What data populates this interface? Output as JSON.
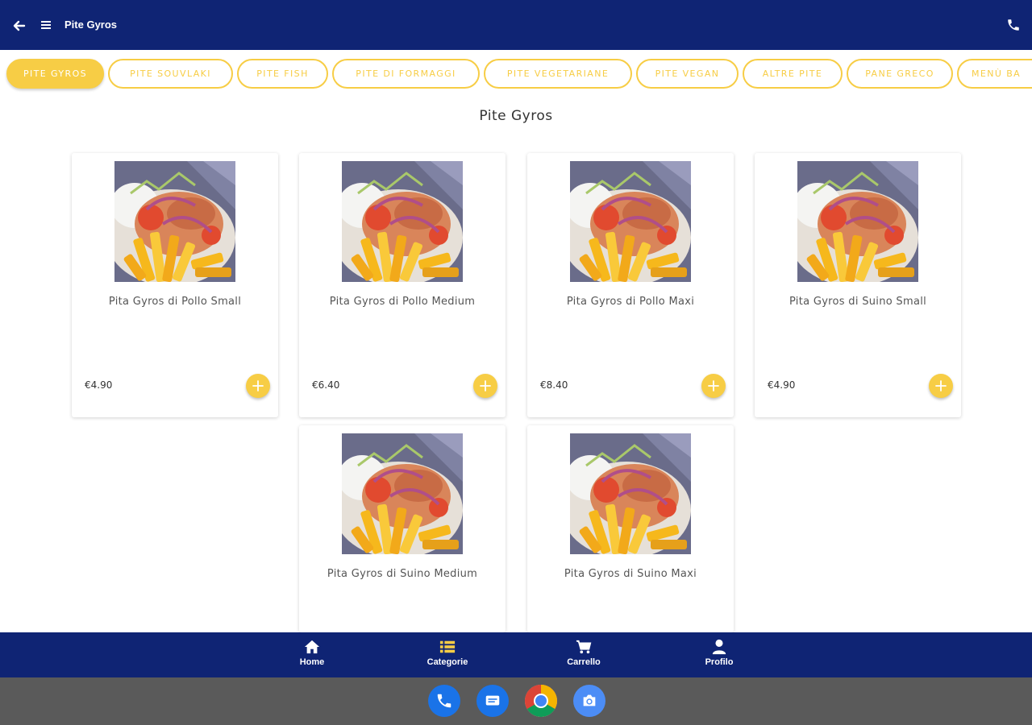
{
  "topbar": {
    "title": "Pite Gyros",
    "back_icon": "arrow-back-icon",
    "menu_icon": "hamburger-menu-icon",
    "phone_icon": "phone-icon"
  },
  "categories": [
    {
      "label": "PITE GYROS",
      "active": true
    },
    {
      "label": "PITE SOUVLAKI",
      "active": false
    },
    {
      "label": "PITE FISH",
      "active": false
    },
    {
      "label": "PITE DI FORMAGGI",
      "active": false
    },
    {
      "label": "PITE VEGETARIANE",
      "active": false
    },
    {
      "label": "PITE VEGAN",
      "active": false
    },
    {
      "label": "ALTRE PITE",
      "active": false
    },
    {
      "label": "PANE GRECO",
      "active": false
    },
    {
      "label": "MENÙ BA",
      "active": false
    }
  ],
  "section_title": "Pite Gyros",
  "products": [
    {
      "name": "Pita Gyros di Pollo Small",
      "price": "€4.90"
    },
    {
      "name": "Pita Gyros di Pollo Medium",
      "price": "€6.40"
    },
    {
      "name": "Pita Gyros di Pollo Maxi",
      "price": "€8.40"
    },
    {
      "name": "Pita Gyros di Suino Small",
      "price": "€4.90"
    },
    {
      "name": "Pita Gyros di Suino Medium",
      "price": ""
    },
    {
      "name": "Pita Gyros di Suino Maxi",
      "price": ""
    }
  ],
  "bottom_nav": [
    {
      "label": "Home",
      "icon": "home-icon"
    },
    {
      "label": "Categorie",
      "icon": "list-icon"
    },
    {
      "label": "Carrello",
      "icon": "cart-icon"
    },
    {
      "label": "Profilo",
      "icon": "person-icon"
    }
  ],
  "dock_apps": [
    "phone-app-icon",
    "messages-app-icon",
    "chrome-app-icon",
    "camera-app-icon"
  ],
  "colors": {
    "primary": "#0f2474",
    "accent": "#f7cd45",
    "dock": "#5a5a5a"
  }
}
